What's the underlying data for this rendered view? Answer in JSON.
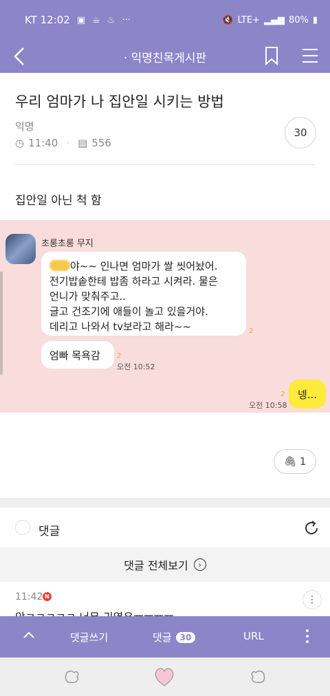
{
  "status_bar": {
    "carrier_time": "KT 12:02",
    "battery": "80%",
    "network": "LTE+"
  },
  "nav": {
    "title": "· 익명친목게시판"
  },
  "post": {
    "title": "우리 엄마가 나 집안일 시키는 방법",
    "author": "익명",
    "time": "11:40",
    "views": "556",
    "comment_count": "30",
    "body": "집안일 아닌 척 함"
  },
  "chat": {
    "sender_name": "초롱초롱 무지",
    "bubble1_lines": [
      "야~~ 인나면 엄마가 쌀 씻어놨어.",
      "전기밥솥한테 밥좀 하라고 시켜라. 물은",
      "언니가 맞춰주고..",
      "글고 건조기에 애들이 놀고 있을거야.",
      "데리고 나와서 tv보라고 해라~~"
    ],
    "bubble2": "엄빠 목욕감",
    "time_received": "오전 10:52",
    "reply": "넹...",
    "time_sent": "오전 10:58",
    "read_mark": "2"
  },
  "attachment": {
    "count": "1"
  },
  "comments": {
    "header": "댓글",
    "view_all": "댓글 전체보기",
    "first": {
      "time": "11:42",
      "badge": "N",
      "text": "앜ㅋㅋㅋㅋㅋ 너무 귀엽유ㅠㅠㅠㅠ"
    }
  },
  "bottom_bar": {
    "write": "댓글쓰기",
    "comments_label": "댓글",
    "comments_count": "30",
    "url": "URL"
  },
  "colors": {
    "brand": "#8c86c8",
    "chat_bg": "#f9dcdc",
    "my_bubble": "#fdea3c"
  }
}
